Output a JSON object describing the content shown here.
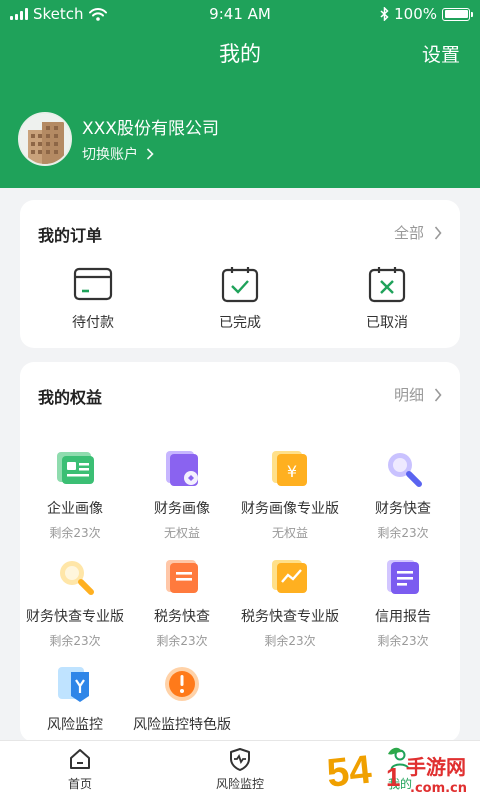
{
  "status_bar": {
    "carrier": "Sketch",
    "time": "9:41 AM",
    "battery": "100%"
  },
  "nav": {
    "title": "我的",
    "settings": "设置"
  },
  "profile": {
    "company": "XXX股份有限公司",
    "switch_label": "切换账户"
  },
  "orders": {
    "title": "我的订单",
    "more": "全部",
    "items": [
      {
        "label": "待付款",
        "icon": "wallet-icon"
      },
      {
        "label": "已完成",
        "icon": "clipboard-check-icon"
      },
      {
        "label": "已取消",
        "icon": "clipboard-x-icon"
      }
    ]
  },
  "benefits": {
    "title": "我的权益",
    "more": "明细",
    "items": [
      {
        "name": "企业画像",
        "sub": "剩余23次",
        "icon": "profile-card-icon"
      },
      {
        "name": "财务画像",
        "sub": "无权益",
        "icon": "finance-portrait-icon"
      },
      {
        "name": "财务画像专业版",
        "sub": "无权益",
        "icon": "yen-doc-icon"
      },
      {
        "name": "财务快查",
        "sub": "剩余23次",
        "icon": "magnifier-icon"
      },
      {
        "name": "财务快查专业版",
        "sub": "剩余23次",
        "icon": "magnifier-pro-icon"
      },
      {
        "name": "税务快查",
        "sub": "剩余23次",
        "icon": "tax-doc-icon"
      },
      {
        "name": "税务快查专业版",
        "sub": "剩余23次",
        "icon": "tax-chart-icon"
      },
      {
        "name": "信用报告",
        "sub": "剩余23次",
        "icon": "report-icon"
      },
      {
        "name": "风险监控",
        "sub": "",
        "icon": "risk-shield-icon"
      },
      {
        "name": "风险监控特色版",
        "sub": "",
        "icon": "warning-icon"
      }
    ]
  },
  "tabbar": {
    "items": [
      {
        "label": "首页",
        "icon": "home-icon"
      },
      {
        "label": "风险监控",
        "icon": "shield-pulse-icon"
      },
      {
        "label": "我的",
        "icon": "user-icon"
      }
    ]
  },
  "watermark": {
    "text": "手游网",
    "url_text": ".com.cn"
  }
}
